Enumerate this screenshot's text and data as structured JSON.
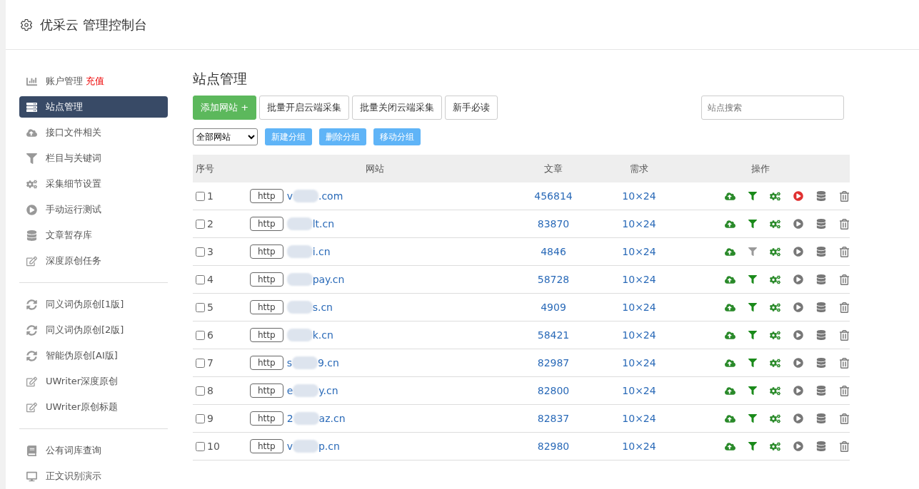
{
  "header": {
    "title": "优采云 管理控制台"
  },
  "sidebar": {
    "groups": [
      [
        {
          "kind": "chart",
          "label": "账户管理",
          "badge": "充值",
          "selected": false
        },
        {
          "kind": "server",
          "label": "站点管理",
          "selected": true
        },
        {
          "kind": "cloud",
          "label": "接口文件相关",
          "selected": false
        },
        {
          "kind": "filter",
          "label": "栏目与关键词",
          "selected": false
        },
        {
          "kind": "cogs",
          "label": "采集细节设置",
          "selected": false
        },
        {
          "kind": "play",
          "label": "手动运行测试",
          "selected": false
        },
        {
          "kind": "database",
          "label": "文章暂存库",
          "selected": false
        },
        {
          "kind": "edit",
          "label": "深度原创任务",
          "selected": false
        }
      ],
      [
        {
          "kind": "refresh",
          "label": "同义词伪原创[1版]",
          "selected": false
        },
        {
          "kind": "refresh",
          "label": "同义词伪原创[2版]",
          "selected": false
        },
        {
          "kind": "refresh",
          "label": "智能伪原创[AI版]",
          "selected": false
        },
        {
          "kind": "edit",
          "label": "UWriter深度原创",
          "selected": false
        },
        {
          "kind": "edit",
          "label": "UWriter原创标题",
          "selected": false
        }
      ],
      [
        {
          "kind": "book",
          "label": "公有词库查询",
          "selected": false
        },
        {
          "kind": "desktop",
          "label": "正文识别演示",
          "selected": false
        }
      ]
    ]
  },
  "main": {
    "title": "站点管理",
    "toolbar": [
      {
        "kind": "primary",
        "label": "添加网站 +"
      },
      {
        "kind": "default",
        "label": "批量开启云端采集"
      },
      {
        "kind": "default",
        "label": "批量关闭云端采集"
      },
      {
        "kind": "default",
        "label": "新手必读"
      }
    ],
    "search": {
      "placeholder": "站点搜索"
    },
    "group_select": {
      "value": "全部网站"
    },
    "group_buttons": [
      "新建分组",
      "删除分组",
      "移动分组"
    ],
    "table": {
      "columns": [
        "序号",
        "网站",
        "文章",
        "需求",
        "操作"
      ],
      "rows": [
        {
          "checked": false,
          "index": "1",
          "protocol": "http",
          "domain_start": "v",
          "domain_end": ".com",
          "articles": "456814",
          "demand": "10×24",
          "filter_on": true,
          "running": true
        },
        {
          "checked": false,
          "index": "2",
          "protocol": "http",
          "domain_start": "",
          "domain_end": "lt.cn",
          "articles": "83870",
          "demand": "10×24",
          "filter_on": true,
          "running": false
        },
        {
          "checked": false,
          "index": "3",
          "protocol": "http",
          "domain_start": "",
          "domain_end": "i.cn",
          "articles": "4846",
          "demand": "10×24",
          "filter_on": false,
          "running": false
        },
        {
          "checked": false,
          "index": "4",
          "protocol": "http",
          "domain_start": "",
          "domain_end": "pay.cn",
          "articles": "58728",
          "demand": "10×24",
          "filter_on": true,
          "running": false
        },
        {
          "checked": false,
          "index": "5",
          "protocol": "http",
          "domain_start": "",
          "domain_end": "s.cn",
          "articles": "4909",
          "demand": "10×24",
          "filter_on": true,
          "running": false
        },
        {
          "checked": false,
          "index": "6",
          "protocol": "http",
          "domain_start": "",
          "domain_end": "k.cn",
          "articles": "58421",
          "demand": "10×24",
          "filter_on": true,
          "running": false
        },
        {
          "checked": false,
          "index": "7",
          "protocol": "http",
          "domain_start": "s",
          "domain_end": "9.cn",
          "articles": "82987",
          "demand": "10×24",
          "filter_on": true,
          "running": false
        },
        {
          "checked": false,
          "index": "8",
          "protocol": "http",
          "domain_start": "e",
          "domain_end": "y.cn",
          "articles": "82800",
          "demand": "10×24",
          "filter_on": true,
          "running": false
        },
        {
          "checked": false,
          "index": "9",
          "protocol": "http",
          "domain_start": "2",
          "domain_end": "az.cn",
          "articles": "82837",
          "demand": "10×24",
          "filter_on": true,
          "running": false
        },
        {
          "checked": false,
          "index": "10",
          "protocol": "http",
          "domain_start": "v",
          "domain_end": "p.cn",
          "articles": "82980",
          "demand": "10×24",
          "filter_on": true,
          "running": false
        }
      ]
    }
  }
}
